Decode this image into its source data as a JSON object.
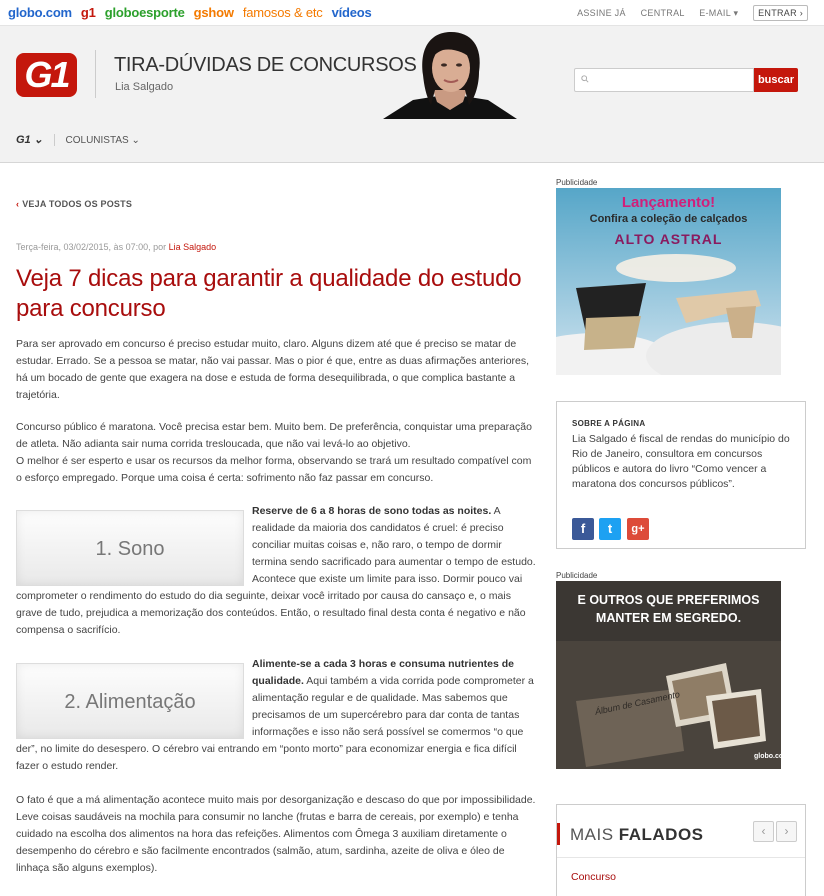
{
  "topbar": {
    "links": [
      "globo.com",
      "g1",
      "globoesporte",
      "gshow",
      "famosos & etc",
      "vídeos"
    ],
    "right": [
      "ASSINE JÁ",
      "CENTRAL",
      "E-MAIL ▾"
    ],
    "login": "ENTRAR ›"
  },
  "header": {
    "logo_text": "G1",
    "blog_title": "TIRA-DÚVIDAS DE CONCURSOS",
    "author": "Lia Salgado",
    "search_placeholder": "",
    "search_button": "buscar",
    "menu_home": "G1 ⌄",
    "menu_columnists": "COLUNISTAS ⌄"
  },
  "article": {
    "back_link": "VEJA TODOS OS POSTS",
    "date": "Terça-feira, 03/02/2015, às 07:00, por",
    "author": "Lia Salgado",
    "title": "Veja 7 dicas para garantir a qualidade do estudo para concurso",
    "p1": "Para ser aprovado em concurso é preciso estudar muito, claro. Alguns dizem até que é preciso se matar de estudar. Errado. Se a pessoa se matar, não vai passar. Mas o pior é que, entre as duas afirmações anteriores, há um bocado de gente que exagera na dose e estuda de forma desequilibrada, o que complica bastante a trajetória.",
    "p2": "Concurso público é maratona. Você precisa estar bem. Muito bem. De preferência, conquistar uma preparação de atleta. Não adianta sair numa corrida tresloucada, que não vai levá-lo ao objetivo.",
    "p3": "O melhor é ser esperto e usar os recursos da melhor forma, observando se trará um resultado compatível com o esforço empregado. Porque uma coisa é certa: sofrimento não faz passar em concurso.",
    "fig1": "1. Sono",
    "tip1_lead": "Reserve de 6 a 8 horas de sono todas as noites.",
    "tip1_body": " A realidade da maioria dos candidatos é cruel: é preciso conciliar muitas coisas e, não raro, o tempo de dormir termina sendo sacrificado para aumentar o tempo de estudo. Acontece que existe um limite para isso. Dormir pouco vai comprometer o rendimento do estudo do dia seguinte, deixar você irritado por causa do cansaço e, o mais grave de tudo, prejudica a memorização dos conteúdos. Então, o resultado final desta conta é negativo e não compensa o sacrifício.",
    "fig2": "2. Alimentação",
    "tip2_lead": "Alimente-se a cada 3 horas e consuma nutrientes de qualidade.",
    "tip2_body": " Aqui também a vida corrida pode comprometer a alimentação regular e de qualidade. Mas sabemos que precisamos de um supercérebro para dar conta de tantas informações e isso não será possível se comermos “o que der”, no limite do desespero. O cérebro vai entrando em “ponto morto” para economizar energia e fica difícil fazer o estudo render.",
    "p4": "O fato é que a má alimentação acontece muito mais por desorganização e descaso do que por impossibilidade. Leve coisas saudáveis na mochila para consumir no lanche (frutas e barra de cereais, por exemplo) e tenha cuidado na escolha dos alimentos na hora das refeições. Alimentos com Ômega 3 auxiliam diretamente o desempenho do cérebro e são facilmente encontrados (salmão, atum, sardinha, azeite de oliva e óleo de linhaça são alguns exemplos)."
  },
  "sidebar": {
    "ad_label": "Publicidade",
    "ad1_title": "Lançamento!",
    "ad1_sub": "Confira a coleção de calçados",
    "ad1_brand": "ALTO ASTRAL",
    "about_heading": "SOBRE A PÁGINA",
    "about_text": "Lia Salgado é fiscal de rendas do município do Rio de Janeiro, consultora em concursos públicos e autora do livro “Como vencer a maratona dos concursos públicos”.",
    "ad2_line1": "E OUTROS QUE PREFERIMOS",
    "ad2_line2": "MANTER EM SEGREDO.",
    "ad2_album": "Álbum de Casamento",
    "ad2_logo": "globo.com",
    "mais_light": "MAIS",
    "mais_bold": "FALADOS",
    "mais_item": "Concurso",
    "colors": {
      "brand_red": "#c4170c",
      "headline_red": "#a80d0d"
    }
  }
}
